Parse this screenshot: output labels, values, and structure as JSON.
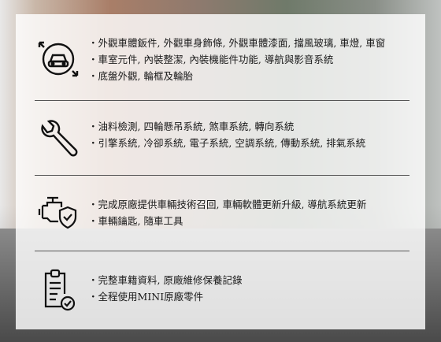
{
  "sections": [
    {
      "icon": "car-inspection-icon",
      "items": [
        "外觀車體鈑件, 外觀車身飾條, 外觀車體漆面, 擋風玻璃, 車燈, 車窗",
        "車室元件, 內裝整潔, 內裝機能件功能, 導航與影音系統",
        "底盤外觀, 輪框及輪胎"
      ]
    },
    {
      "icon": "wrench-icon",
      "items": [
        "油料檢測, 四輪懸吊系統, 煞車系統, 轉向系統",
        "引擎系統, 冷卻系統, 電子系統, 空調系統, 傳動系統, 排氣系統"
      ]
    },
    {
      "icon": "engine-shield-icon",
      "items": [
        "完成原廠提供車輛技術召回, 車輛軟體更新升級, 導航系統更新",
        "車輛鑰匙, 隨車工具"
      ]
    },
    {
      "icon": "clipboard-check-icon",
      "items": [
        "完整車籍資料, 原廠維修保養記錄",
        "全程使用MINI原廠零件"
      ]
    }
  ]
}
